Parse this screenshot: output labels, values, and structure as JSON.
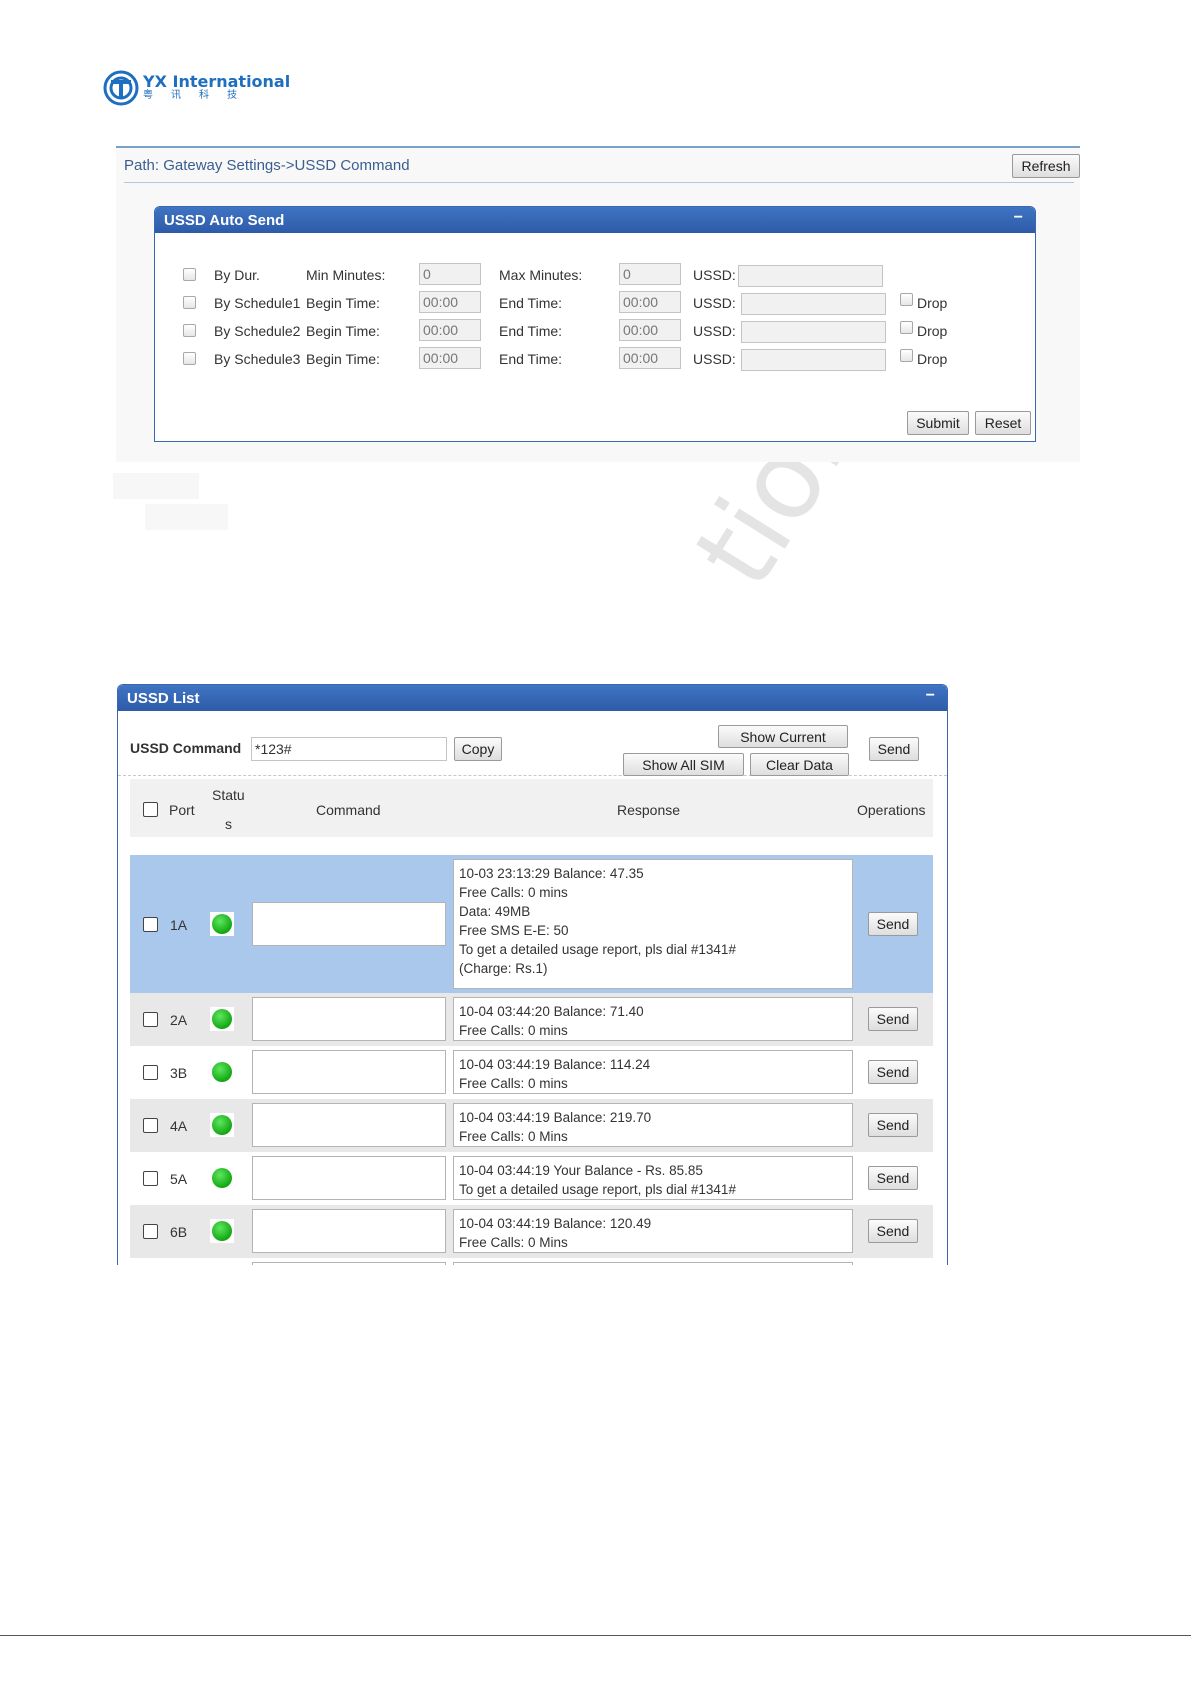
{
  "logo": {
    "name": "YX International",
    "sub": "粤讯科技"
  },
  "path": {
    "text": "Path: Gateway Settings->USSD Command",
    "refresh_label": "Refresh"
  },
  "auto_send": {
    "title": "USSD Auto Send",
    "minimize": "−",
    "by_dur": {
      "label": "By Dur.",
      "min_label": "Min Minutes:",
      "min_value": "0",
      "max_label": "Max Minutes:",
      "max_value": "0",
      "ussd_label": "USSD:"
    },
    "schedules": [
      {
        "label": "By Schedule1",
        "begin_label": "Begin Time:",
        "begin_value": "00:00",
        "end_label": "End Time:",
        "end_value": "00:00",
        "ussd_label": "USSD:",
        "drop_label": "Drop"
      },
      {
        "label": "By Schedule2",
        "begin_label": "Begin Time:",
        "begin_value": "00:00",
        "end_label": "End Time:",
        "end_value": "00:00",
        "ussd_label": "USSD:",
        "drop_label": "Drop"
      },
      {
        "label": "By Schedule3",
        "begin_label": "Begin Time:",
        "begin_value": "00:00",
        "end_label": "End Time:",
        "end_value": "00:00",
        "ussd_label": "USSD:",
        "drop_label": "Drop"
      }
    ],
    "submit_label": "Submit",
    "reset_label": "Reset"
  },
  "ussd_list": {
    "title": "USSD List",
    "minimize": "−",
    "command_label": "USSD Command",
    "command_value": "*123#",
    "copy_label": "Copy",
    "show_current_label": "Show Current",
    "show_all_label": "Show All SIM",
    "clear_label": "Clear Data",
    "send_label": "Send",
    "columns": {
      "port": "Port",
      "status_1": "Statu",
      "status_2": "s",
      "command": "Command",
      "response": "Response",
      "operations": "Operations"
    },
    "rows": [
      {
        "port": "1A",
        "response": "10-03 23:13:29 Balance: 47.35\nFree Calls: 0 mins\nData: 49MB\nFree SMS E-E: 50\nTo get a detailed usage report, pls dial #1341#\n(Charge: Rs.1)",
        "send": "Send"
      },
      {
        "port": "2A",
        "response": "10-04 03:44:20 Balance: 71.40\nFree Calls: 0 mins",
        "send": "Send"
      },
      {
        "port": "3B",
        "response": "10-04 03:44:19 Balance: 114.24\nFree Calls: 0 mins",
        "send": "Send"
      },
      {
        "port": "4A",
        "response": "10-04 03:44:19 Balance: 219.70\nFree Calls: 0 Mins",
        "send": "Send"
      },
      {
        "port": "5A",
        "response": "10-04 03:44:19 Your Balance - Rs. 85.85\nTo get a detailed usage report, pls dial #1341#",
        "send": "Send"
      },
      {
        "port": "6B",
        "response": "10-04 03:44:19 Balance: 120.49\nFree Calls: 0 Mins",
        "send": "Send"
      }
    ]
  },
  "watermark": "tion Co., Lt"
}
